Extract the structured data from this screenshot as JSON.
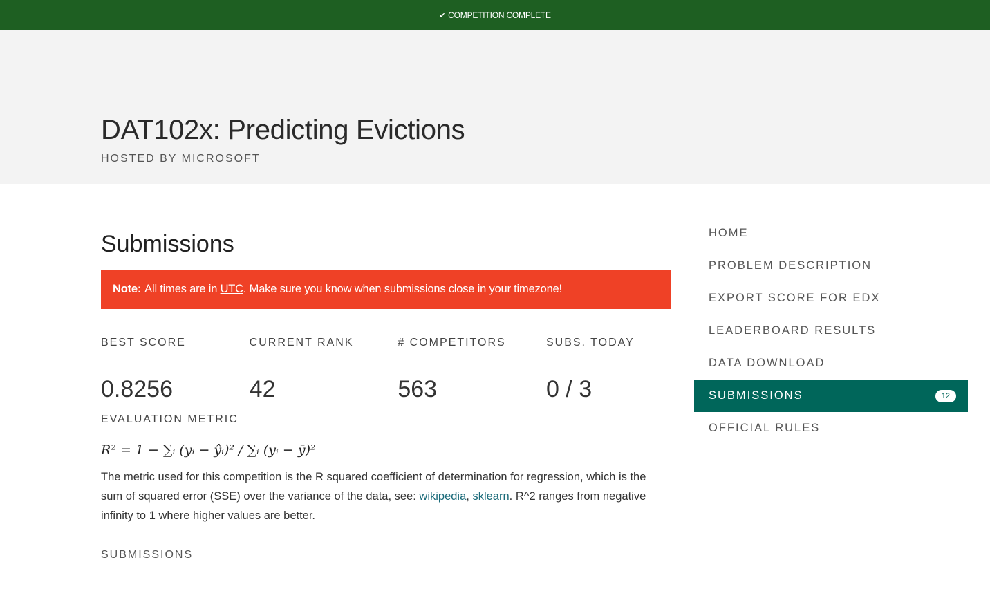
{
  "banner": {
    "icon": "check-icon",
    "text": "COMPETITION COMPLETE"
  },
  "hero": {
    "title": "DAT102x: Predicting Evictions",
    "host": "HOSTED BY MICROSOFT"
  },
  "main": {
    "title": "Submissions",
    "note": {
      "label": "Note:",
      "text_before": "All times are in",
      "link": "UTC",
      "text_after": ". Make sure you know when submissions close in your timezone!"
    },
    "stats": [
      {
        "label": "BEST SCORE",
        "value": "0.8256"
      },
      {
        "label": "CURRENT RANK",
        "value": "42"
      },
      {
        "label": "# COMPETITORS",
        "value": "563"
      },
      {
        "label": "SUBS. TODAY",
        "value": "0 / 3"
      }
    ],
    "eval_label": "EVALUATION METRIC",
    "formula": "R² = 1 − ∑ᵢ (yᵢ − ŷᵢ)² / ∑ᵢ (yᵢ − ȳ)²",
    "description": {
      "text1": "The metric used for this competition is the R squared coefficient of determination for regression, which is the sum of squared error (SSE) over the variance of the data, see:",
      "link1": "wikipedia",
      "sep": ",",
      "link2": "sklearn",
      "text2": ". R^2 ranges from negative infinity to 1 where higher values are better."
    },
    "submissions_label": "SUBMISSIONS"
  },
  "nav": {
    "items": [
      {
        "label": "HOME"
      },
      {
        "label": "PROBLEM DESCRIPTION"
      },
      {
        "label": "EXPORT SCORE FOR EDX"
      },
      {
        "label": "LEADERBOARD RESULTS"
      },
      {
        "label": "DATA DOWNLOAD"
      },
      {
        "label": "SUBMISSIONS",
        "badge": "12"
      },
      {
        "label": "OFFICIAL RULES"
      }
    ]
  },
  "colors": {
    "banner": "#1e5f22",
    "note": "#ef4126",
    "active_nav": "#00665a"
  }
}
